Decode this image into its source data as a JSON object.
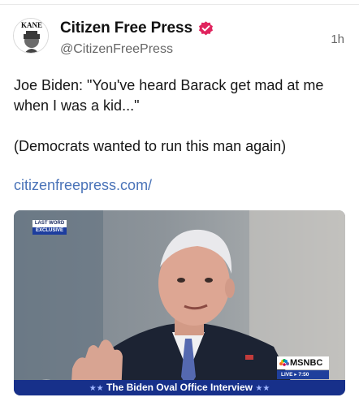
{
  "post": {
    "display_name": "Citizen Free Press",
    "handle": "@CitizenFreePress",
    "timestamp": "1h",
    "text_line1": "Joe Biden: \"You've heard Barack get mad at me when I was a kid...\"",
    "text_line2": "(Democrats wanted to run this man again)",
    "link": "citizenfreepress.com/"
  },
  "avatar": {
    "logo_text": "KANE"
  },
  "media": {
    "show_badge_top": "LAST WORD",
    "show_badge_bottom": "EXCLUSIVE",
    "network": "MSNBC",
    "live_label": "LIVE",
    "live_time": "7:50",
    "lower_third": "The Biden Oval Office Interview",
    "stars_left": "★★",
    "stars_right": "★★"
  },
  "colors": {
    "verified": "#e0245e",
    "link": "#4a73b8",
    "lower_third_bg": "#17308a"
  },
  "icons": {
    "verified": "verified-badge-icon",
    "peacock": "peacock-icon"
  }
}
